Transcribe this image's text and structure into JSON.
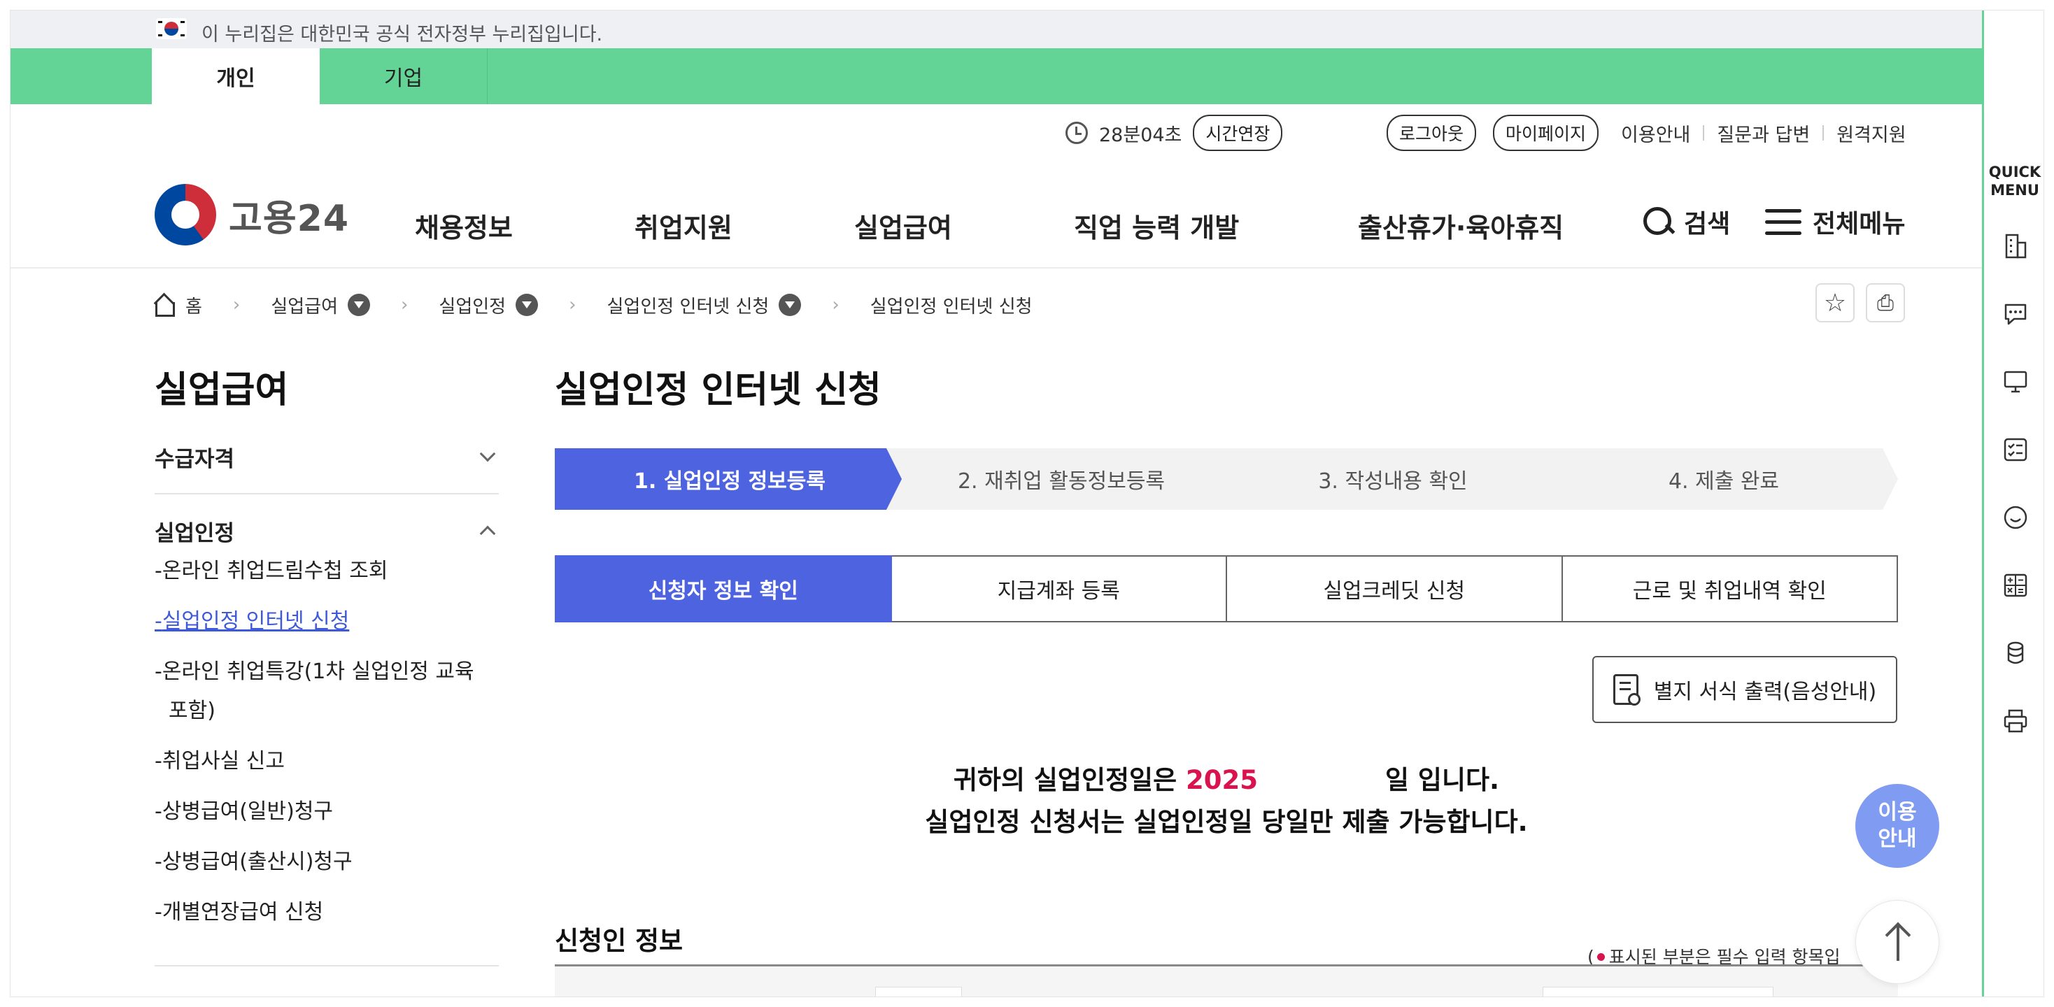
{
  "gov_banner": {
    "text": "이 누리집은 대한민국 공식 전자정부 누리집입니다."
  },
  "audience_tabs": [
    {
      "label": "개인"
    },
    {
      "label": "기업"
    }
  ],
  "utility": {
    "timer": "28분04초",
    "extend_label": "시간연장",
    "logout_label": "로그아웃",
    "mypage_label": "마이페이지",
    "links": [
      "이용안내",
      "질문과 답변",
      "원격지원"
    ]
  },
  "header": {
    "logo_text": "고용24",
    "gnb": [
      "채용정보",
      "취업지원",
      "실업급여",
      "직업 능력 개발",
      "출산휴가·육아휴직"
    ],
    "search_label": "검색",
    "menu_label": "전체메뉴"
  },
  "breadcrumb": [
    "홈",
    "실업급여",
    "실업인정",
    "실업인정 인터넷 신청",
    "실업인정 인터넷 신청"
  ],
  "lnb": {
    "title": "실업급여",
    "sections": [
      {
        "label": "수급자격"
      },
      {
        "label": "실업인정"
      }
    ],
    "sub_items": [
      "온라인 취업드림수첩 조회",
      "실업인정 인터넷 신청",
      "온라인 취업특강(1차 실업인정 교육 포함)",
      "취업사실 신고",
      "상병급여(일반)청구",
      "상병급여(출산시)청구",
      "개별연장급여 신청"
    ]
  },
  "main": {
    "title": "실업인정 인터넷 신청",
    "steps": [
      "1. 실업인정 정보등록",
      "2. 재취업 활동정보등록",
      "3. 작성내용 확인",
      "4. 제출 완료"
    ],
    "subtabs": [
      "신청자 정보 확인",
      "지급계좌 등록",
      "실업크레딧 신청",
      "근로 및 취업내역 확인"
    ],
    "print_label": "별지 서식 출력(음성안내)",
    "notice_line1_prefix": "귀하의 실업인정일은 ",
    "notice_year": "2025",
    "notice_line1_suffix": "일 입니다.",
    "notice_line2": "실업인정 신청서는 실업인정일 당일만 제출 가능합니다.",
    "section_title": "신청인 정보",
    "required_note_open": "(",
    "required_note": "표시된 부분은 필수 입력 항목입"
  },
  "help_fab": {
    "line1": "이용",
    "line2": "안내"
  },
  "quick_menu": {
    "title_line1": "QUICK",
    "title_line2": "MENU",
    "icons": [
      "building-icon",
      "chat-icon",
      "monitor-icon",
      "checklist-icon",
      "smile-icon",
      "calculator-icon",
      "coins-icon",
      "printer-icon"
    ]
  },
  "colors": {
    "primary": "#4d63df",
    "green": "#63d495",
    "accent_red": "#d9134d",
    "fab": "#7f9cf2"
  }
}
